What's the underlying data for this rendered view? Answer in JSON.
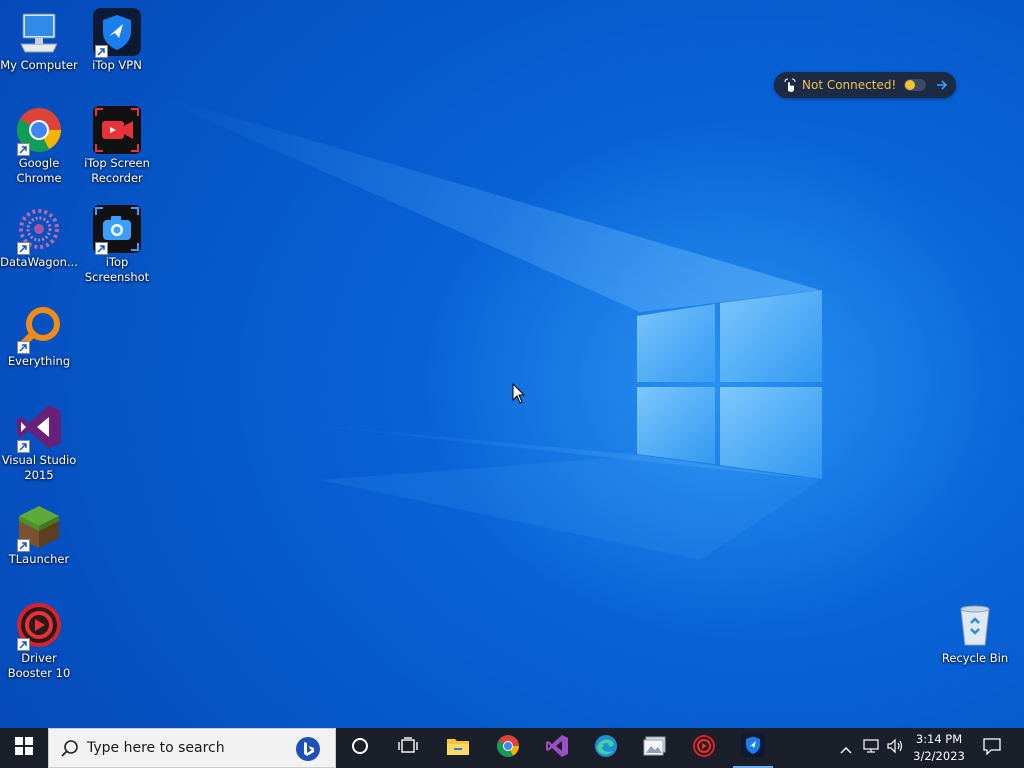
{
  "desktop": {
    "icons": [
      {
        "name": "my-computer",
        "label": "My Computer"
      },
      {
        "name": "itop-vpn",
        "label": "iTop VPN"
      },
      {
        "name": "google-chrome",
        "label": "Google Chrome"
      },
      {
        "name": "itop-screen-recorder",
        "label": "iTop Screen Recorder"
      },
      {
        "name": "datawagon",
        "label": "DataWagon..."
      },
      {
        "name": "itop-screenshot",
        "label": "iTop Screenshot"
      },
      {
        "name": "everything",
        "label": "Everything"
      },
      {
        "name": "visual-studio-2015",
        "label": "Visual Studio 2015"
      },
      {
        "name": "tlauncher",
        "label": "TLauncher"
      },
      {
        "name": "driver-booster-10",
        "label": "Driver Booster 10"
      },
      {
        "name": "recycle-bin",
        "label": "Recycle Bin"
      }
    ]
  },
  "vpn_widget": {
    "status": "Not Connected!",
    "status_color": "#f4c24b",
    "toggle_on": false
  },
  "taskbar": {
    "search_placeholder": "Type here to search",
    "pinned": [
      "start-icon",
      "cortana-icon",
      "task-view-icon",
      "file-explorer-icon",
      "chrome-icon",
      "visual-studio-icon",
      "edge-icon",
      "photo-icon",
      "driver-booster-icon",
      "itop-vpn-icon"
    ],
    "clock_time": "3:14 PM",
    "clock_date": "3/2/2023"
  },
  "colors": {
    "wallpaper": "#0a5fd6",
    "taskbar": "#1b1f2a",
    "accent": "#f4c24b"
  }
}
